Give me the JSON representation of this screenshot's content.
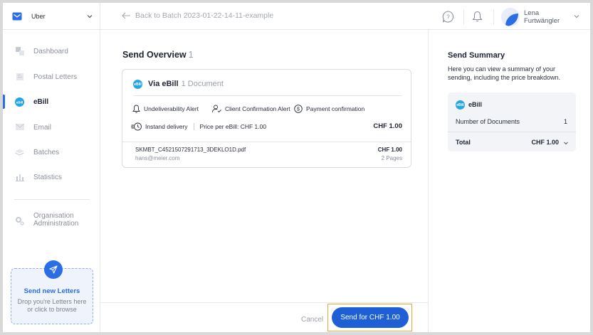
{
  "sidebar": {
    "org_name": "Uber",
    "nav": [
      {
        "label": "Dashboard"
      },
      {
        "label": "Postal Letters"
      },
      {
        "label": "eBill"
      },
      {
        "label": "Email"
      },
      {
        "label": "Batches"
      },
      {
        "label": "Statistics"
      }
    ],
    "admin_label_1": "Organisation",
    "admin_label_2": "Administration",
    "upload_title": "Send new Letters",
    "upload_sub": "Drop you're Letters here or click to browse"
  },
  "topbar": {
    "back_label": "Back to Batch 2023-01-22-14-11-example",
    "user_first": "Lena",
    "user_last": "Furtwängler"
  },
  "main": {
    "title": "Send Overview",
    "count": "1",
    "card": {
      "logo_text": "eBill",
      "title": "Via eBill",
      "subtitle": "1 Document",
      "features": [
        "Undeliverability Alert",
        "Client Confirmation Alert",
        "Payment confirmation"
      ],
      "delivery": "Instand delivery",
      "price_per": "Price per eBill: CHF 1.00",
      "price_total": "CHF 1.00",
      "file": {
        "name": "SKMBT_C4521507291713_3DEKLO1D.pdf",
        "email": "hans@meier.com",
        "price": "CHF 1.00",
        "pages": "2 Pages"
      }
    },
    "cancel_label": "Cancel",
    "send_label": "Send for CHF 1.00"
  },
  "summary": {
    "title": "Send Summary",
    "desc": "Here you can view a summary of your sending, including the price breakdown.",
    "logo_text": "eBill",
    "channel": "eBill",
    "docs_label": "Number of Documents",
    "docs_value": "1",
    "total_label": "Total",
    "total_value": "CHF 1.00"
  },
  "colors": {
    "accent": "#2b6de5",
    "send_button": "#1f5fd6",
    "ebill_logo": "#27a6e0",
    "highlight_border": "#f2a33a"
  }
}
